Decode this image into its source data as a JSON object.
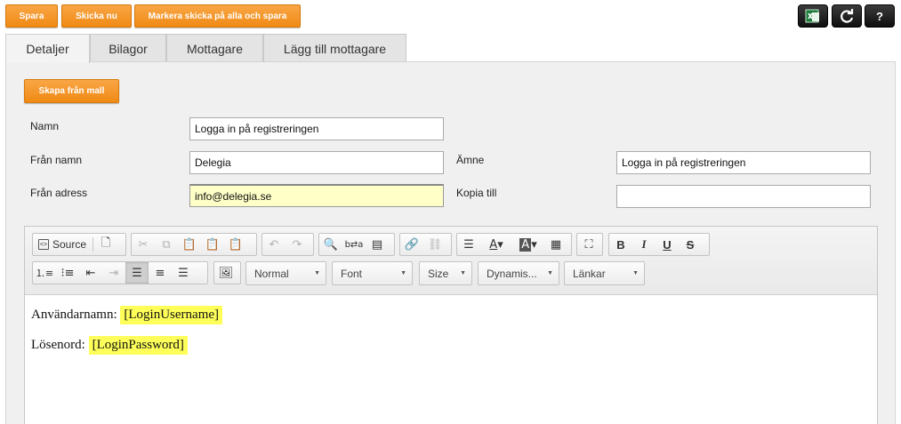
{
  "top_actions": {
    "save": "Spara",
    "send_now": "Skicka nu",
    "mark_sent_save": "Markera skicka på alla och spara"
  },
  "top_icons": {
    "help": "?"
  },
  "tabs": [
    {
      "label": "Detaljer",
      "active": true
    },
    {
      "label": "Bilagor",
      "active": false
    },
    {
      "label": "Mottagare",
      "active": false
    },
    {
      "label": "Lägg till mottagare",
      "active": false
    }
  ],
  "template_button": "Skapa från mall",
  "form": {
    "name_label": "Namn",
    "name_value": "Logga in på registreringen",
    "from_name_label": "Från namn",
    "from_name_value": "Delegia",
    "subject_label": "Ämne",
    "subject_value": "Logga in på registreringen",
    "from_address_label": "Från adress",
    "from_address_value": "info@delegia.se",
    "cc_label": "Kopia till",
    "cc_value": ""
  },
  "editor": {
    "source_label": "Source",
    "combos": {
      "format": "Normal",
      "font": "Font",
      "size": "Size",
      "dynamic": "Dynamis...",
      "links": "Länkar"
    },
    "lines": [
      {
        "prefix": "Användarnamn:",
        "tag": "[LoginUsername]"
      },
      {
        "prefix": "Lösenord:",
        "tag": "[LoginPassword]"
      }
    ]
  },
  "colors": {
    "accent": "#f39a2a",
    "highlight_field": "#ffffc8",
    "tag_highlight": "#ffff5a"
  }
}
